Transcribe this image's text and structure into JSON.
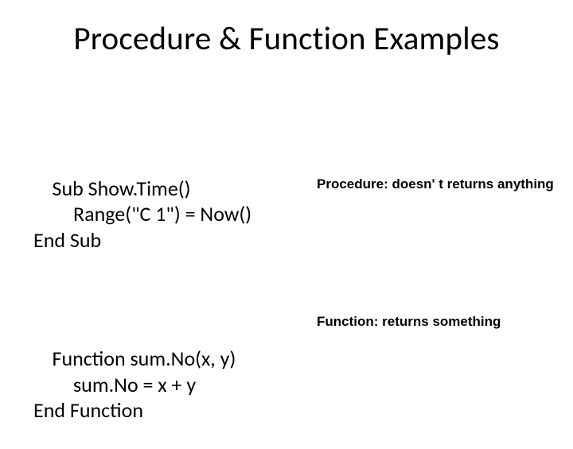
{
  "title": "Procedure & Function Examples",
  "code1": {
    "line1": "Sub Show.Time()",
    "line2": "Range(\"C 1\") = Now()",
    "line3": "End Sub"
  },
  "annotation1": "Procedure: doesn' t returns anything",
  "code2": {
    "line1": "Function sum.No(x, y)",
    "line2": "sum.No = x + y",
    "line3": "End Function"
  },
  "annotation2": "Function: returns something"
}
